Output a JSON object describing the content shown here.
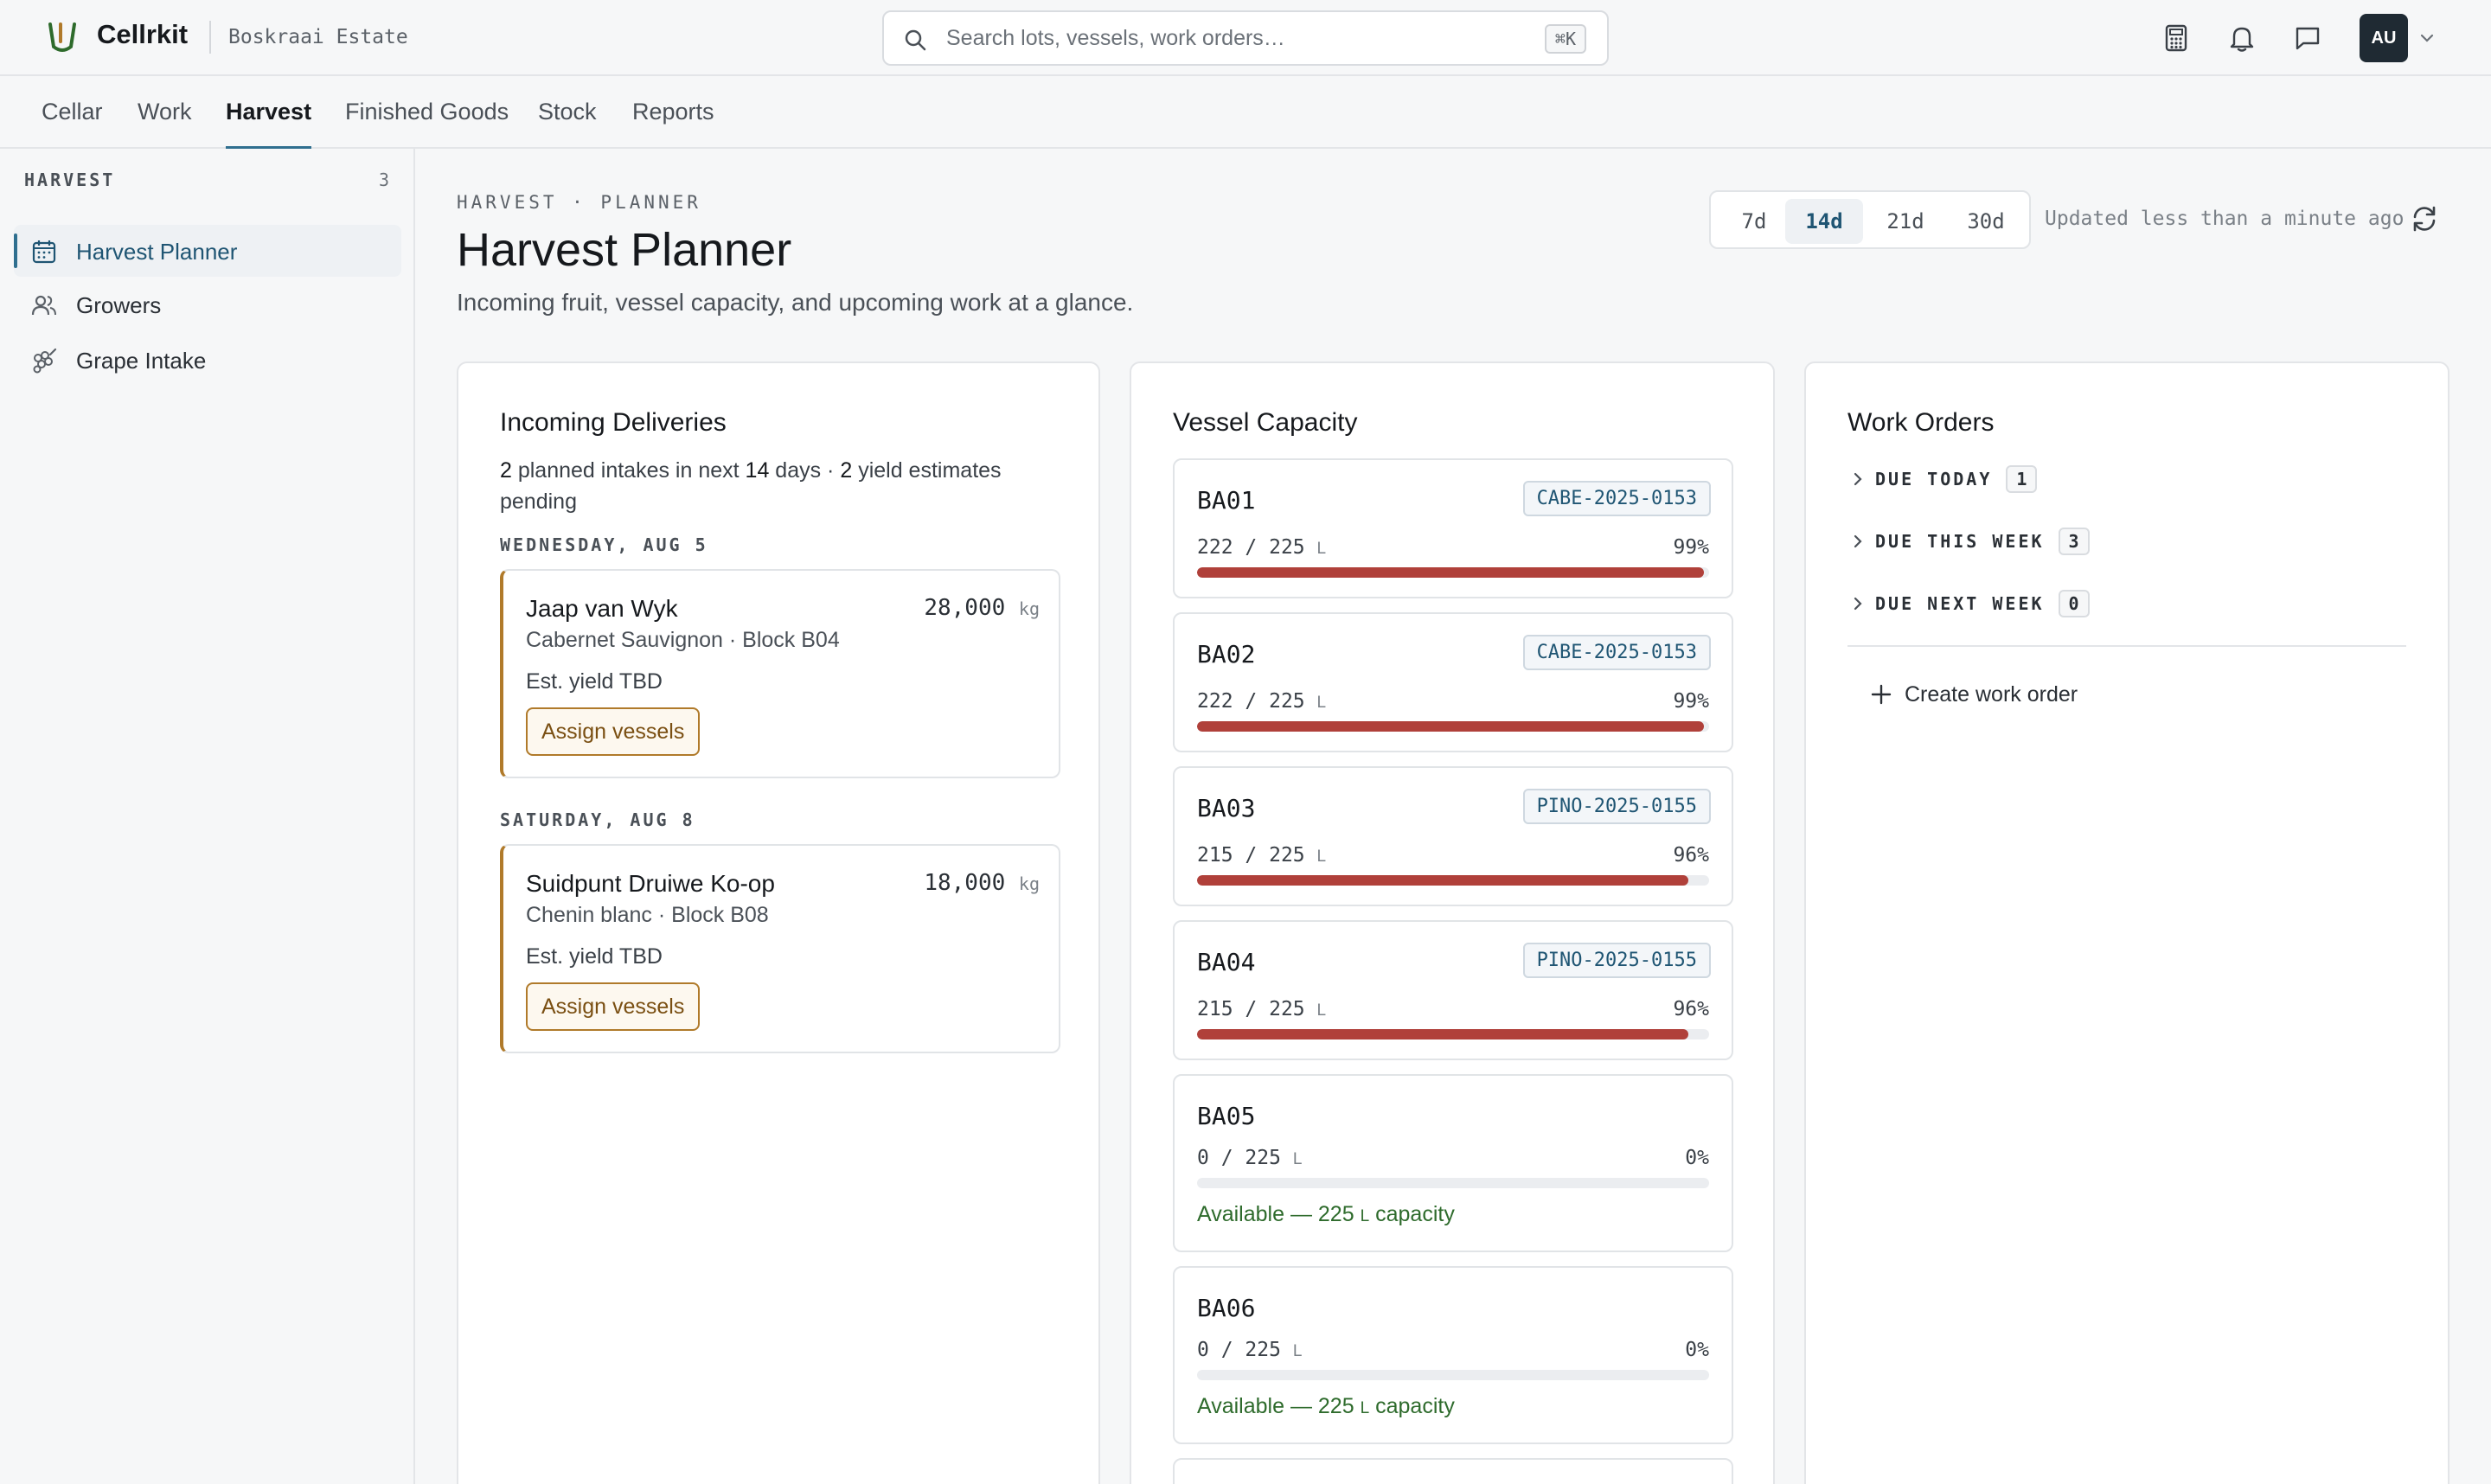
{
  "app": {
    "name": "Cellrkit",
    "estate": "Boskraai Estate"
  },
  "search": {
    "placeholder": "Search lots, vessels, work orders…",
    "shortcut": "⌘K"
  },
  "user": {
    "initials": "AU"
  },
  "nav": {
    "tabs": [
      {
        "label": "Cellar"
      },
      {
        "label": "Work"
      },
      {
        "label": "Harvest",
        "active": true
      },
      {
        "label": "Finished Goods"
      },
      {
        "label": "Stock"
      },
      {
        "label": "Reports"
      }
    ]
  },
  "sidebar": {
    "heading": "HARVEST",
    "count": "3",
    "items": [
      {
        "label": "Harvest Planner",
        "icon": "calendar-icon",
        "active": true
      },
      {
        "label": "Growers",
        "icon": "users-icon"
      },
      {
        "label": "Grape Intake",
        "icon": "grapes-icon"
      }
    ]
  },
  "page": {
    "breadcrumb": "HARVEST · PLANNER",
    "title": "Harvest Planner",
    "subtitle": "Incoming fruit, vessel capacity, and upcoming work at a glance.",
    "ranges": [
      "7d",
      "14d",
      "21d",
      "30d"
    ],
    "selected_range": "14d",
    "updated": "Updated less than a minute ago"
  },
  "deliveries": {
    "title": "Incoming Deliveries",
    "summary": {
      "planned": "2",
      "planned_text": " planned intakes in next ",
      "days": "14",
      "days_text": " days · ",
      "pending": "2",
      "pending_text": " yield estimates pending"
    },
    "groups": [
      {
        "day": "WEDNESDAY, AUG 5",
        "items": [
          {
            "grower": "Jaap van Wyk",
            "kg": "28,000",
            "kg_unit": "kg",
            "variety": "Cabernet Sauvignon · Block B04",
            "yield": "Est. yield TBD",
            "action": "Assign vessels"
          }
        ]
      },
      {
        "day": "SATURDAY, AUG 8",
        "items": [
          {
            "grower": "Suidpunt Druiwe Ko-op",
            "kg": "18,000",
            "kg_unit": "kg",
            "variety": "Chenin blanc · Block B08",
            "yield": "Est. yield TBD",
            "action": "Assign vessels"
          }
        ]
      }
    ]
  },
  "vessels": {
    "title": "Vessel Capacity",
    "unit": "L",
    "items": [
      {
        "name": "BA01",
        "lot": "CABE-2025-0153",
        "used": "222",
        "capacity": "225",
        "pct": "99%",
        "fill": 0.99
      },
      {
        "name": "BA02",
        "lot": "CABE-2025-0153",
        "used": "222",
        "capacity": "225",
        "pct": "99%",
        "fill": 0.99
      },
      {
        "name": "BA03",
        "lot": "PINO-2025-0155",
        "used": "215",
        "capacity": "225",
        "pct": "96%",
        "fill": 0.96
      },
      {
        "name": "BA04",
        "lot": "PINO-2025-0155",
        "used": "215",
        "capacity": "225",
        "pct": "96%",
        "fill": 0.96
      },
      {
        "name": "BA05",
        "lot": "",
        "used": "0",
        "capacity": "225",
        "pct": "0%",
        "fill": 0,
        "available_prefix": "Available — ",
        "available_amount": "225",
        "available_suffix": " capacity"
      },
      {
        "name": "BA06",
        "lot": "",
        "used": "0",
        "capacity": "225",
        "pct": "0%",
        "fill": 0,
        "available_prefix": "Available — ",
        "available_amount": "225",
        "available_suffix": " capacity"
      }
    ]
  },
  "work_orders": {
    "title": "Work Orders",
    "groups": [
      {
        "label": "DUE TODAY",
        "count": "1"
      },
      {
        "label": "DUE THIS WEEK",
        "count": "3"
      },
      {
        "label": "DUE NEXT WEEK",
        "count": "0"
      }
    ],
    "create_label": "Create work order"
  },
  "colors": {
    "accent": "#2f6f8f",
    "warn": "#b0403a",
    "ok": "#2e6b2c",
    "amber": "#b07a2a"
  }
}
